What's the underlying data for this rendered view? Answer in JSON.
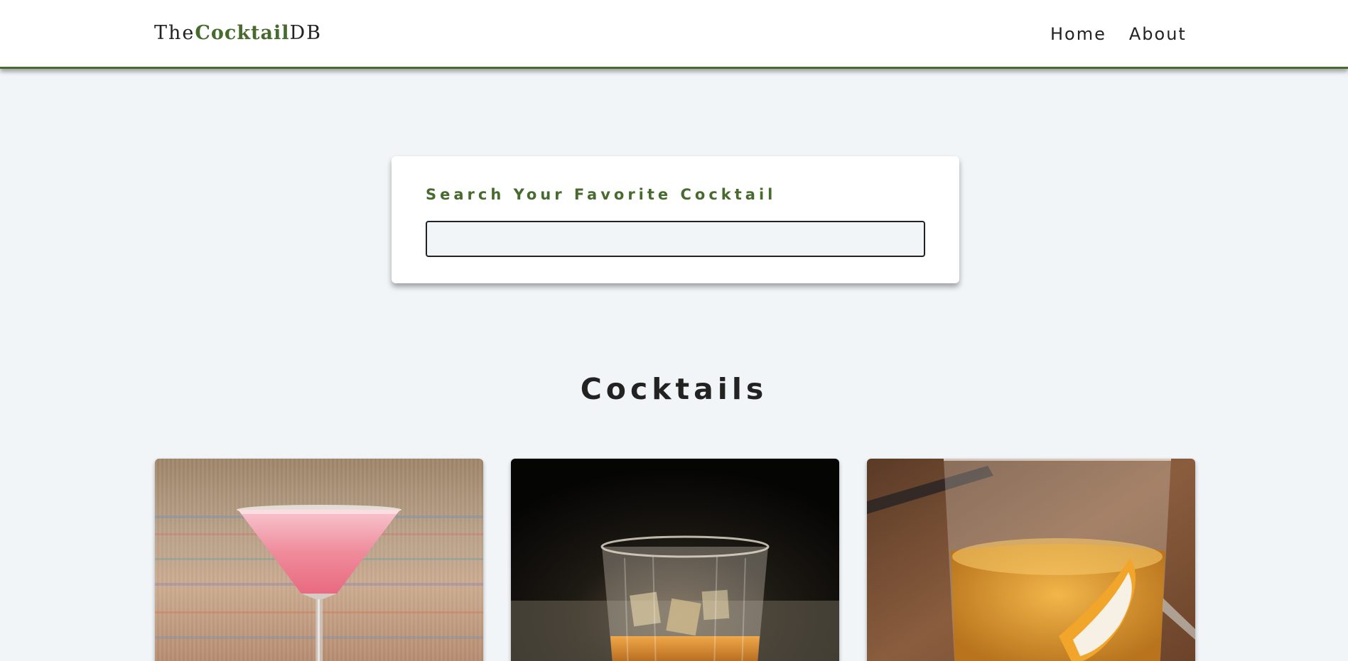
{
  "navbar": {
    "logo_prefix": "The",
    "logo_accent": "Cocktail",
    "logo_suffix": "DB",
    "links": [
      {
        "label": "Home"
      },
      {
        "label": "About"
      }
    ]
  },
  "search": {
    "label": "Search Your Favorite Cocktail",
    "value": ""
  },
  "section": {
    "title": "Cocktails"
  },
  "cocktails": [
    {
      "image": "pink-martini-glass-photo"
    },
    {
      "image": "whiskey-on-rocks-photo"
    },
    {
      "image": "amber-drink-with-orange-peel-photo"
    }
  ],
  "colors": {
    "accent": "#476a2e",
    "background": "#f1f5f8",
    "text": "#222222"
  }
}
